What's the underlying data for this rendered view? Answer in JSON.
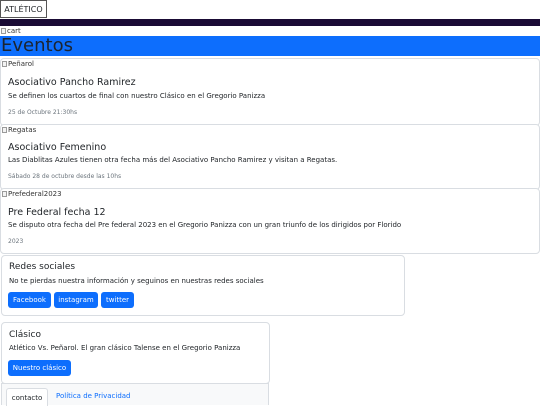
{
  "navbar": {
    "brand": "ATLÉTICO",
    "cart_alt": "cart"
  },
  "section_title": "Eventos",
  "events": [
    {
      "img_alt": "Peñarol",
      "title": "Asociativo Pancho Ramirez",
      "text": "Se definen los cuartos de final con nuestro Clásico en el Gregorio Panizza",
      "date": "25 de Octubre 21:30hs"
    },
    {
      "img_alt": "Regatas",
      "title": "Asociativo Femenino",
      "text": "Las Diablitas Azules tienen otra fecha más del Asociativo Pancho Ramirez y visitan a Regatas.",
      "date": "Sábado 28 de octubre desde las 10hs"
    },
    {
      "img_alt": "Prefederal2023",
      "title": "Pre Federal fecha 12",
      "text": "Se disputo otra fecha del Pre federal 2023 en el Gregorio Panizza con un gran triunfo de los dirigidos por Florido",
      "date": "2023"
    }
  ],
  "social": {
    "title": "Redes sociales",
    "text": "No te pierdas nuestra información y seguinos en nuestras redes sociales",
    "buttons": [
      "Facebook",
      "instagram",
      "twitter"
    ]
  },
  "clasico": {
    "title": "Clásico",
    "text": "Atlético Vs. Peñarol. El gran clásico Talense en el Gregorio Panizza",
    "button": "Nuestro clásico"
  },
  "footer": {
    "tabs": [
      "contacto",
      "Política de Privacidad"
    ]
  },
  "colors": {
    "primary": "#0d6efd",
    "dark_bar": "#1a0b35"
  }
}
